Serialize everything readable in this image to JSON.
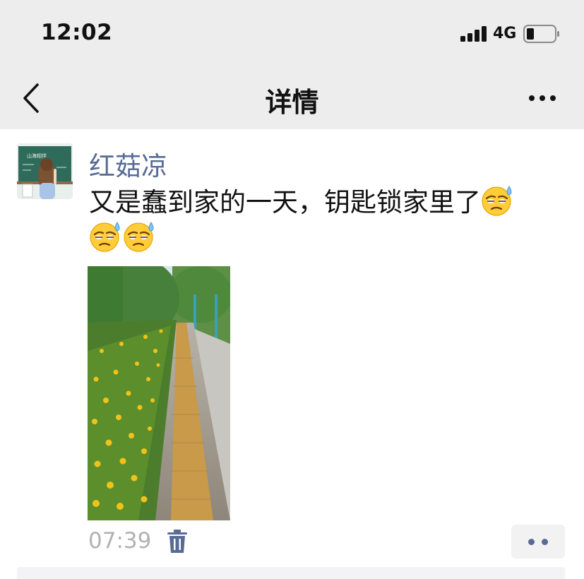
{
  "status_bar": {
    "time": "12:02",
    "network": "4G",
    "icons": [
      "signal-icon",
      "battery-icon"
    ]
  },
  "nav": {
    "title": "详情",
    "icons": [
      "back-icon",
      "more-icon"
    ]
  },
  "post": {
    "author": "红菇凉",
    "text": "又是蠢到家的一天，钥匙锁家里了",
    "emojis": [
      "sweat-emoji",
      "sweat-emoji",
      "sweat-emoji"
    ],
    "time": "07:39",
    "icons": [
      "delete-icon",
      "more-actions-icon"
    ]
  },
  "colors": {
    "nav_background": "#ededed",
    "author_link": "#576b95",
    "timestamp": "#b2b2b2"
  }
}
